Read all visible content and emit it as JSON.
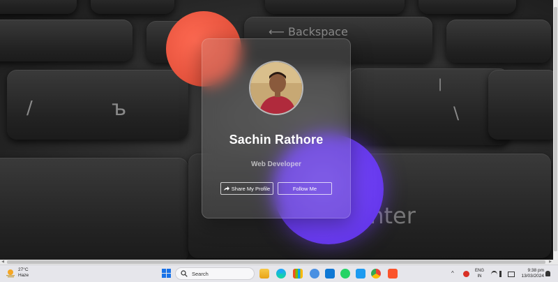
{
  "profile": {
    "name": "Sachin Rathore",
    "role": "Web Developer",
    "share_label": "Share My Profile",
    "follow_label": "Follow Me"
  },
  "taskbar": {
    "weather_temp": "27°C",
    "weather_desc": "Haze",
    "search_placeholder": "Search",
    "lang_1": "ENG",
    "lang_2": "IN",
    "time": "9:38 pm",
    "date": "13/03/2024",
    "apps": [
      "file-explorer",
      "edge",
      "microsoft-store",
      "widgets",
      "mail",
      "whatsapp",
      "twitter",
      "chrome",
      "brave"
    ]
  },
  "colors": {
    "red_blob": "#e8553f",
    "purple_blob": "#6a3cf0",
    "taskbar": "#e6e6eb"
  }
}
